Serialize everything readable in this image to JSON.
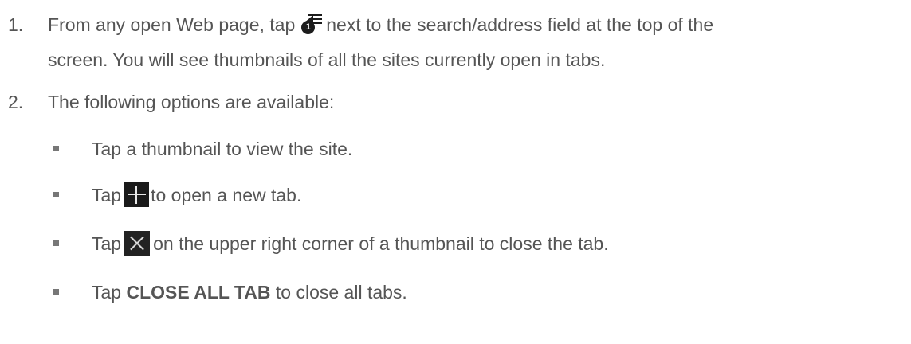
{
  "steps": [
    {
      "number": "1.",
      "line1_before": "From any open Web page, tap",
      "line1_icon": "tabs-icon",
      "line1_after": "next to the search/address field at the top of the",
      "line2": "screen. You will see thumbnails of all the sites currently open in tabs.",
      "tab_count": "1"
    },
    {
      "number": "2.",
      "text": "The following options are available:"
    }
  ],
  "options": [
    {
      "text": "Tap a thumbnail to view the site."
    },
    {
      "before": "Tap",
      "icon": "plus-icon",
      "after": "to open a new tab."
    },
    {
      "before": "Tap",
      "icon": "close-icon",
      "after": "on the upper right corner of a thumbnail to close the tab."
    },
    {
      "before": "Tap",
      "bold": "CLOSE ALL TAB",
      "after": "to close all tabs."
    }
  ],
  "colors": {
    "text": "#555555",
    "bullet": "#777777",
    "icon_background": "#1a1a1a"
  }
}
